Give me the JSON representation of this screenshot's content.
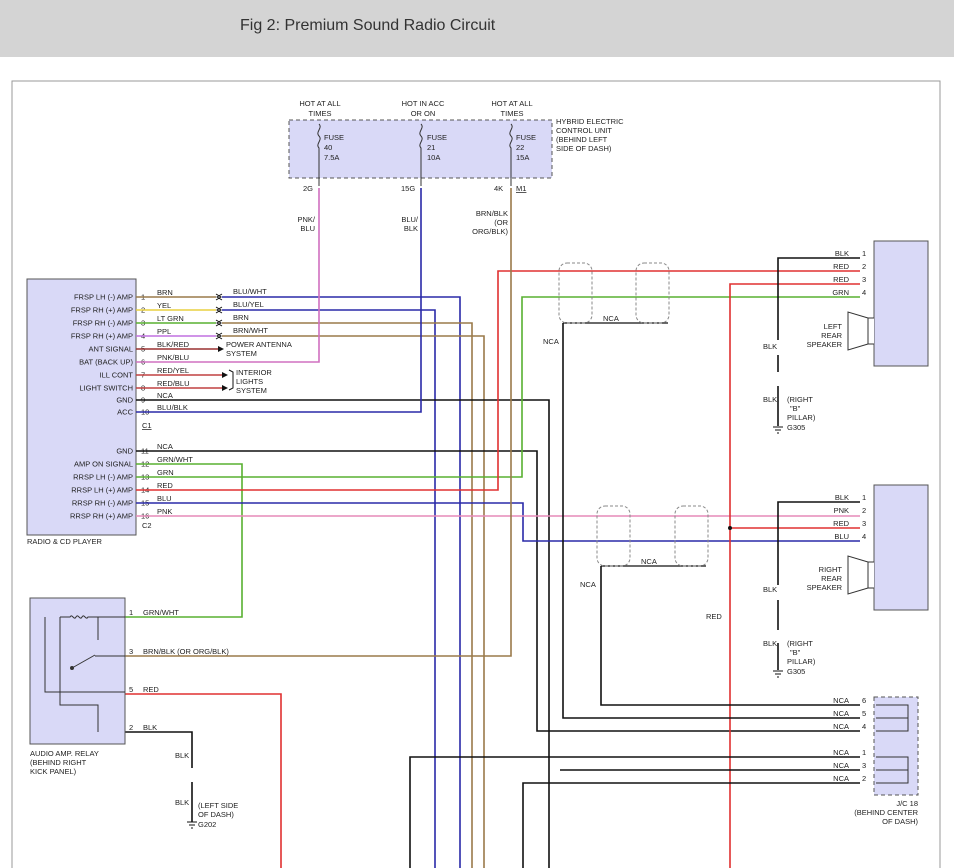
{
  "header": {
    "title": "Fig 2: Premium Sound Radio Circuit"
  },
  "colors": {
    "component_fill": "#d9d9f7",
    "red": "#e03030",
    "blue": "#2a2aa8",
    "pink": "#e68ab8",
    "green": "#58b030",
    "yellow": "#e8d040",
    "brown": "#9a7a4a",
    "black": "#111111",
    "violet": "#c070e0"
  },
  "fuse_block": {
    "headers": [
      {
        "l1": "HOT AT ALL",
        "l2": "TIMES"
      },
      {
        "l1": "HOT IN ACC",
        "l2": "OR ON"
      },
      {
        "l1": "HOT AT ALL",
        "l2": "TIMES"
      }
    ],
    "fuses": [
      {
        "name": "FUSE",
        "num": "40",
        "amps": "7.5A",
        "term": "2G"
      },
      {
        "name": "FUSE",
        "num": "21",
        "amps": "10A",
        "term": "15G"
      },
      {
        "name": "FUSE",
        "num": "22",
        "amps": "15A",
        "term": "4K"
      }
    ],
    "m1": "M1",
    "unit_label": [
      "HYBRID ELECTRIC",
      "CONTROL UNIT",
      "(BEHIND LEFT",
      "SIDE OF DASH)"
    ],
    "wire_labels": [
      [
        "PNK/",
        "BLU"
      ],
      [
        "BLU/",
        "BLK"
      ],
      [
        "BRN/BLK",
        "(OR",
        "ORG/BLK)"
      ]
    ]
  },
  "radio": {
    "name": "RADIO & CD PLAYER",
    "c1": "C1",
    "c2": "C2",
    "pins": [
      {
        "label": "FRSP LH (-) AMP",
        "num": "1",
        "wire": "BRN",
        "ext": "BLU/WHT"
      },
      {
        "label": "FRSP RH (+) AMP",
        "num": "2",
        "wire": "YEL",
        "ext": "BLU/YEL"
      },
      {
        "label": "FRSP RH (-) AMP",
        "num": "3",
        "wire": "LT GRN",
        "ext": "BRN"
      },
      {
        "label": "FRSP RH (+) AMP",
        "num": "4",
        "wire": "PPL",
        "ext": "BRN/WHT"
      },
      {
        "label": "ANT SIGNAL",
        "num": "5",
        "wire": "BLK/RED",
        "ext": ""
      },
      {
        "label": "BAT (BACK UP)",
        "num": "6",
        "wire": "PNK/BLU",
        "ext": ""
      },
      {
        "label": "ILL CONT",
        "num": "7",
        "wire": "RED/YEL",
        "ext": ""
      },
      {
        "label": "LIGHT SWITCH",
        "num": "8",
        "wire": "RED/BLU",
        "ext": ""
      },
      {
        "label": "GND",
        "num": "9",
        "wire": "NCA",
        "ext": ""
      },
      {
        "label": "ACC",
        "num": "10",
        "wire": "BLU/BLK",
        "ext": ""
      },
      {
        "label": "GND",
        "num": "11",
        "wire": "NCA",
        "ext": ""
      },
      {
        "label": "AMP ON SIGNAL",
        "num": "12",
        "wire": "GRN/WHT",
        "ext": ""
      },
      {
        "label": "RRSP LH (-) AMP",
        "num": "13",
        "wire": "GRN",
        "ext": ""
      },
      {
        "label": "RRSP LH (+) AMP",
        "num": "14",
        "wire": "RED",
        "ext": ""
      },
      {
        "label": "RRSP RH (-) AMP",
        "num": "15",
        "wire": "BLU",
        "ext": ""
      },
      {
        "label": "RRSP RH (+) AMP",
        "num": "16",
        "wire": "PNK",
        "ext": ""
      }
    ],
    "power_antenna": [
      "POWER ANTENNA",
      "SYSTEM"
    ],
    "interior_lights": [
      "INTERIOR",
      "LIGHTS",
      "SYSTEM"
    ]
  },
  "left_speaker": {
    "label": [
      "LEFT",
      "REAR",
      "SPEAKER"
    ],
    "pins": [
      {
        "wire": "BLK",
        "num": "1"
      },
      {
        "wire": "RED",
        "num": "2"
      },
      {
        "wire": "RED",
        "num": "3"
      },
      {
        "wire": "GRN",
        "num": "4"
      }
    ],
    "gnd_wire": "BLK",
    "gnd_wire2": "BLK",
    "gnd_loc": [
      "(RIGHT",
      "\"B\"",
      "PILLAR)"
    ],
    "gnd_id": "G305"
  },
  "right_speaker": {
    "label": [
      "RIGHT",
      "REAR",
      "SPEAKER"
    ],
    "pins": [
      {
        "wire": "BLK",
        "num": "1"
      },
      {
        "wire": "PNK",
        "num": "2"
      },
      {
        "wire": "RED",
        "num": "3"
      },
      {
        "wire": "BLU",
        "num": "4"
      }
    ],
    "gnd_wire": "BLK",
    "gnd_wire2": "BLK",
    "gnd_loc": [
      "(RIGHT",
      "\"B\"",
      "PILLAR)"
    ],
    "gnd_id": "G305"
  },
  "shield_labels": {
    "nca_top_mid": "NCA",
    "nca_top_left": "NCA",
    "nca_mid_mid": "NCA",
    "nca_mid_left": "NCA",
    "red_label": "RED"
  },
  "amp_relay": {
    "name": [
      "AUDIO AMP. RELAY",
      "(BEHIND RIGHT",
      "KICK PANEL)"
    ],
    "pins": [
      {
        "num": "1",
        "wire": "GRN/WHT"
      },
      {
        "num": "3",
        "wire": "BRN/BLK (OR ORG/BLK)"
      },
      {
        "num": "5",
        "wire": "RED"
      },
      {
        "num": "2",
        "wire": "BLK"
      }
    ],
    "gnd_wire": "BLK",
    "gnd_wire2": "BLK",
    "gnd_loc": [
      "(LEFT SIDE",
      "OF DASH)"
    ],
    "gnd_id": "G202"
  },
  "jc": {
    "name": [
      "J/C 18",
      "(BEHIND CENTER",
      "OF DASH)"
    ],
    "pins": [
      {
        "wire": "NCA",
        "num": "6"
      },
      {
        "wire": "NCA",
        "num": "5"
      },
      {
        "wire": "NCA",
        "num": "4"
      },
      {
        "wire": "NCA",
        "num": "1"
      },
      {
        "wire": "NCA",
        "num": "3"
      },
      {
        "wire": "NCA",
        "num": "2"
      }
    ]
  }
}
